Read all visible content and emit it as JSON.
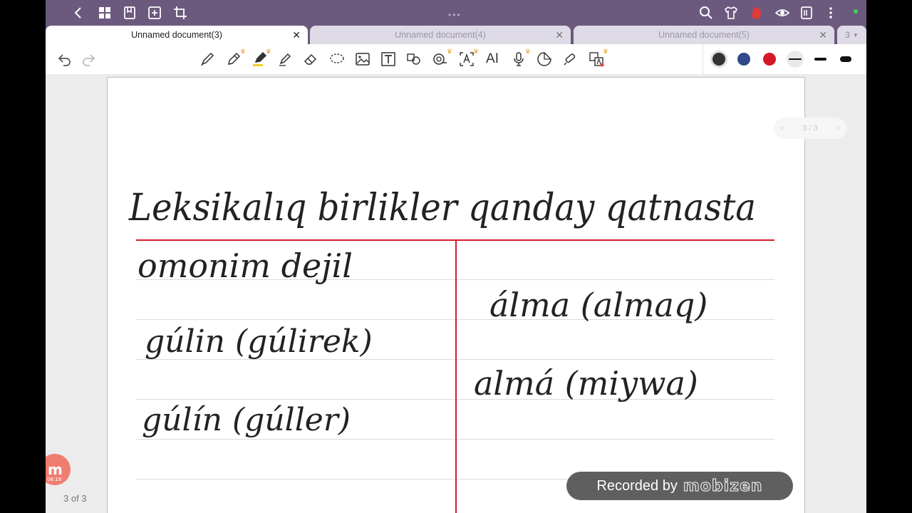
{
  "tabs": [
    {
      "label": "Unnamed document(3)",
      "active": true
    },
    {
      "label": "Unnamed document(4)",
      "active": false
    },
    {
      "label": "Unnamed document(5)",
      "active": false
    }
  ],
  "tab_overflow": "3",
  "pager": {
    "label": "3 / 3"
  },
  "page_count": "3 of 3",
  "recorder": {
    "prefix": "Recorded by",
    "brand": "mobizen",
    "bubble_time": "06:18"
  },
  "pen_colors": [
    "#333333",
    "#2f4a8a",
    "#d4182a"
  ],
  "handwriting": {
    "title": "Leksikalıq birlikler qanday qatnasta",
    "left": [
      "omonim dejil",
      "gúlin (gúlirek)",
      "gúlín (gúller)"
    ],
    "right": [
      "álma (almaq)",
      "almá (miywa)"
    ]
  }
}
